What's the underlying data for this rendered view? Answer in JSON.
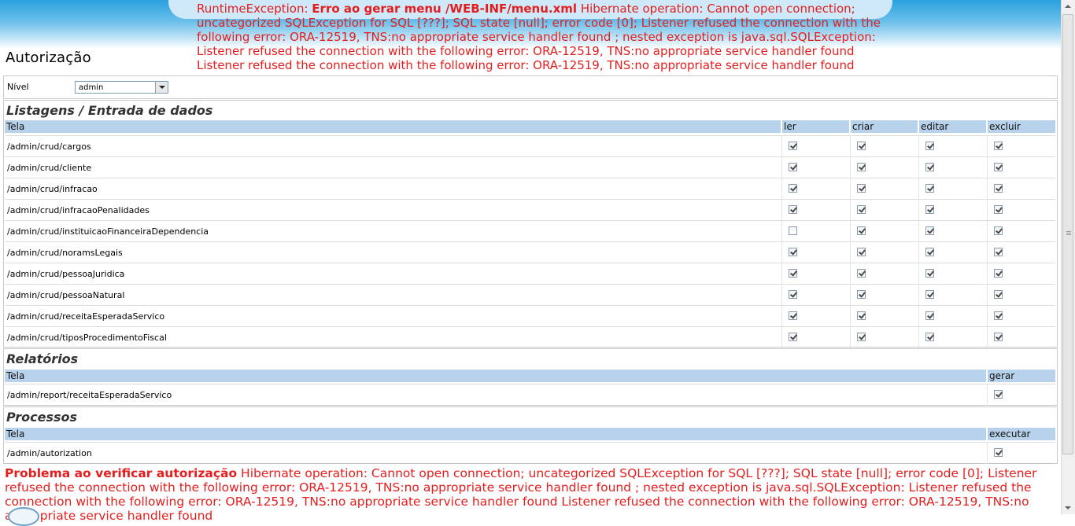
{
  "top_error": {
    "prefix": "RuntimeException: ",
    "bold": "Erro ao gerar menu /WEB-INF/menu.xml",
    "message": " Hibernate operation: Cannot open connection; uncategorized SQLException for SQL [???]; SQL state [null]; error code [0]; Listener refused the connection with the following error: ORA-12519, TNS:no appropriate service handler found ; nested exception is java.sql.SQLException: Listener refused the connection with the following error: ORA-12519, TNS:no appropriate service handler found Listener refused the connection with the following error: ORA-12519, TNS:no appropriate service handler found"
  },
  "page_title": "Autorização",
  "nivel": {
    "label": "Nível",
    "value": "admin"
  },
  "listagens": {
    "title": "Listagens / Entrada de dados",
    "headers": {
      "tela": "Tela",
      "ler": "ler",
      "criar": "criar",
      "editar": "editar",
      "excluir": "excluir"
    },
    "rows": [
      {
        "path": "/admin/crud/cargos",
        "ler": true,
        "criar": true,
        "editar": true,
        "excluir": true
      },
      {
        "path": "/admin/crud/cliente",
        "ler": true,
        "criar": true,
        "editar": true,
        "excluir": true
      },
      {
        "path": "/admin/crud/infracao",
        "ler": true,
        "criar": true,
        "editar": true,
        "excluir": true
      },
      {
        "path": "/admin/crud/infracaoPenalidades",
        "ler": true,
        "criar": true,
        "editar": true,
        "excluir": true
      },
      {
        "path": "/admin/crud/instituicaoFinanceiraDependencia",
        "ler": false,
        "criar": true,
        "editar": true,
        "excluir": true
      },
      {
        "path": "/admin/crud/noramsLegais",
        "ler": true,
        "criar": true,
        "editar": true,
        "excluir": true
      },
      {
        "path": "/admin/crud/pessoaJuridica",
        "ler": true,
        "criar": true,
        "editar": true,
        "excluir": true
      },
      {
        "path": "/admin/crud/pessoaNatural",
        "ler": true,
        "criar": true,
        "editar": true,
        "excluir": true
      },
      {
        "path": "/admin/crud/receitaEsperadaServico",
        "ler": true,
        "criar": true,
        "editar": true,
        "excluir": true
      },
      {
        "path": "/admin/crud/tiposProcedimentoFiscal",
        "ler": true,
        "criar": true,
        "editar": true,
        "excluir": true
      }
    ]
  },
  "relatorios": {
    "title": "Relatórios",
    "headers": {
      "tela": "Tela",
      "gerar": "gerar"
    },
    "rows": [
      {
        "path": "/admin/report/receitaEsperadaServico",
        "gerar": true
      }
    ]
  },
  "processos": {
    "title": "Processos",
    "headers": {
      "tela": "Tela",
      "executar": "executar"
    },
    "rows": [
      {
        "path": "/admin/autorization",
        "executar": true
      }
    ]
  },
  "bottom_error": {
    "bold": "Problema ao verificar autorização",
    "message": " Hibernate operation: Cannot open connection; uncategorized SQLException for SQL [???]; SQL state [null]; error code [0]; Listener refused the connection with the following error: ORA-12519, TNS:no appropriate service handler found ; nested exception is java.sql.SQLException: Listener refused the connection with the following error: ORA-12519, TNS:no appropriate service handler found Listener refused the connection with the following error: ORA-12519, TNS:no appropriate service handler found"
  },
  "colors": {
    "error": "#e41e1e",
    "header_bg": "#b8d2ec",
    "banner": "#2aa1de"
  }
}
